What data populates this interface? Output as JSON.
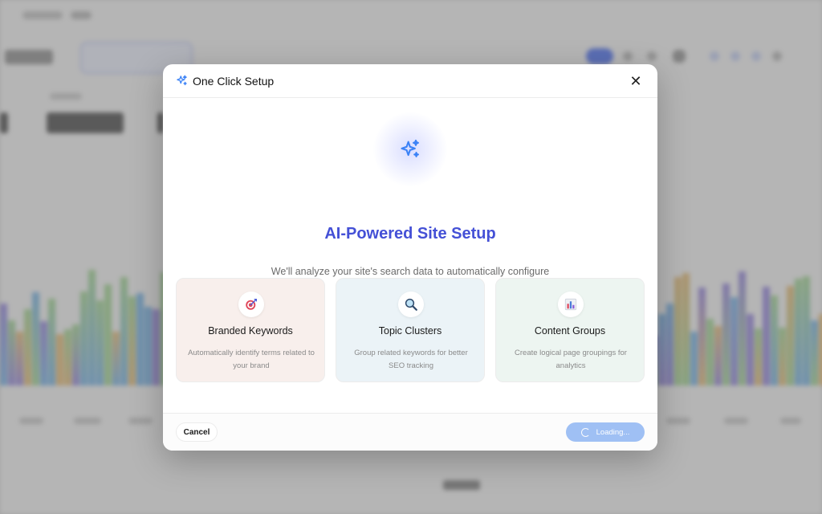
{
  "modal": {
    "title": "One Click Setup",
    "header_icon": "sparkles-icon",
    "close_icon": "close-icon",
    "close_glyph": "✕"
  },
  "hero": {
    "icon": "sparkles-icon",
    "title": "AI-Powered Site Setup",
    "description": "We'll analyze your site's search data to automatically configure your SEO workspace."
  },
  "cards": [
    {
      "icon": "target-icon",
      "title": "Branded Keywords",
      "description": "Automatically identify terms related to your brand"
    },
    {
      "icon": "magnifier-icon",
      "title": "Topic Clusters",
      "description": "Group related keywords for better SEO tracking"
    },
    {
      "icon": "bar-chart-icon",
      "title": "Content Groups",
      "description": "Create logical page groupings for analytics"
    }
  ],
  "footer": {
    "cancel_label": "Cancel",
    "loading_label": "Loading..."
  },
  "colors": {
    "accent": "#4450d6",
    "sparkle": "#3b82f6",
    "loading_button": "#9fc0f4",
    "card_branded": "#f8efec",
    "card_topic": "#ebf3f7",
    "card_content": "#edf5f1"
  }
}
